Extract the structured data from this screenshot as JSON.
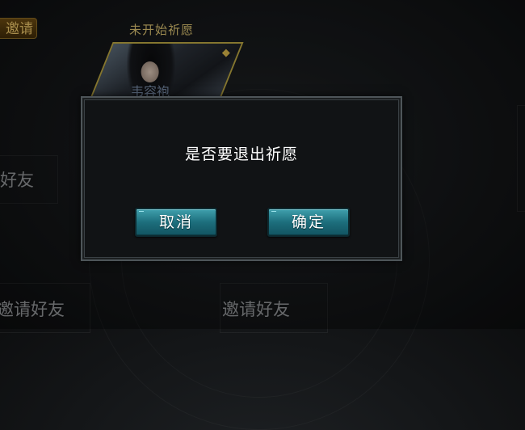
{
  "background": {
    "invite_tab": "邀请",
    "wish_status": "未开始祈愿",
    "portrait_name": "韦容袍",
    "left_invite": "好友",
    "bottom_left_invite": "邀请好友",
    "bottom_center_invite": "邀请好友"
  },
  "dialog": {
    "message": "是否要退出祈愿",
    "cancel_label": "取消",
    "confirm_label": "确定"
  },
  "colors": {
    "button_teal": "#1d6e7c",
    "dialog_bg": "#111315",
    "gold_text": "#d8bf70"
  }
}
